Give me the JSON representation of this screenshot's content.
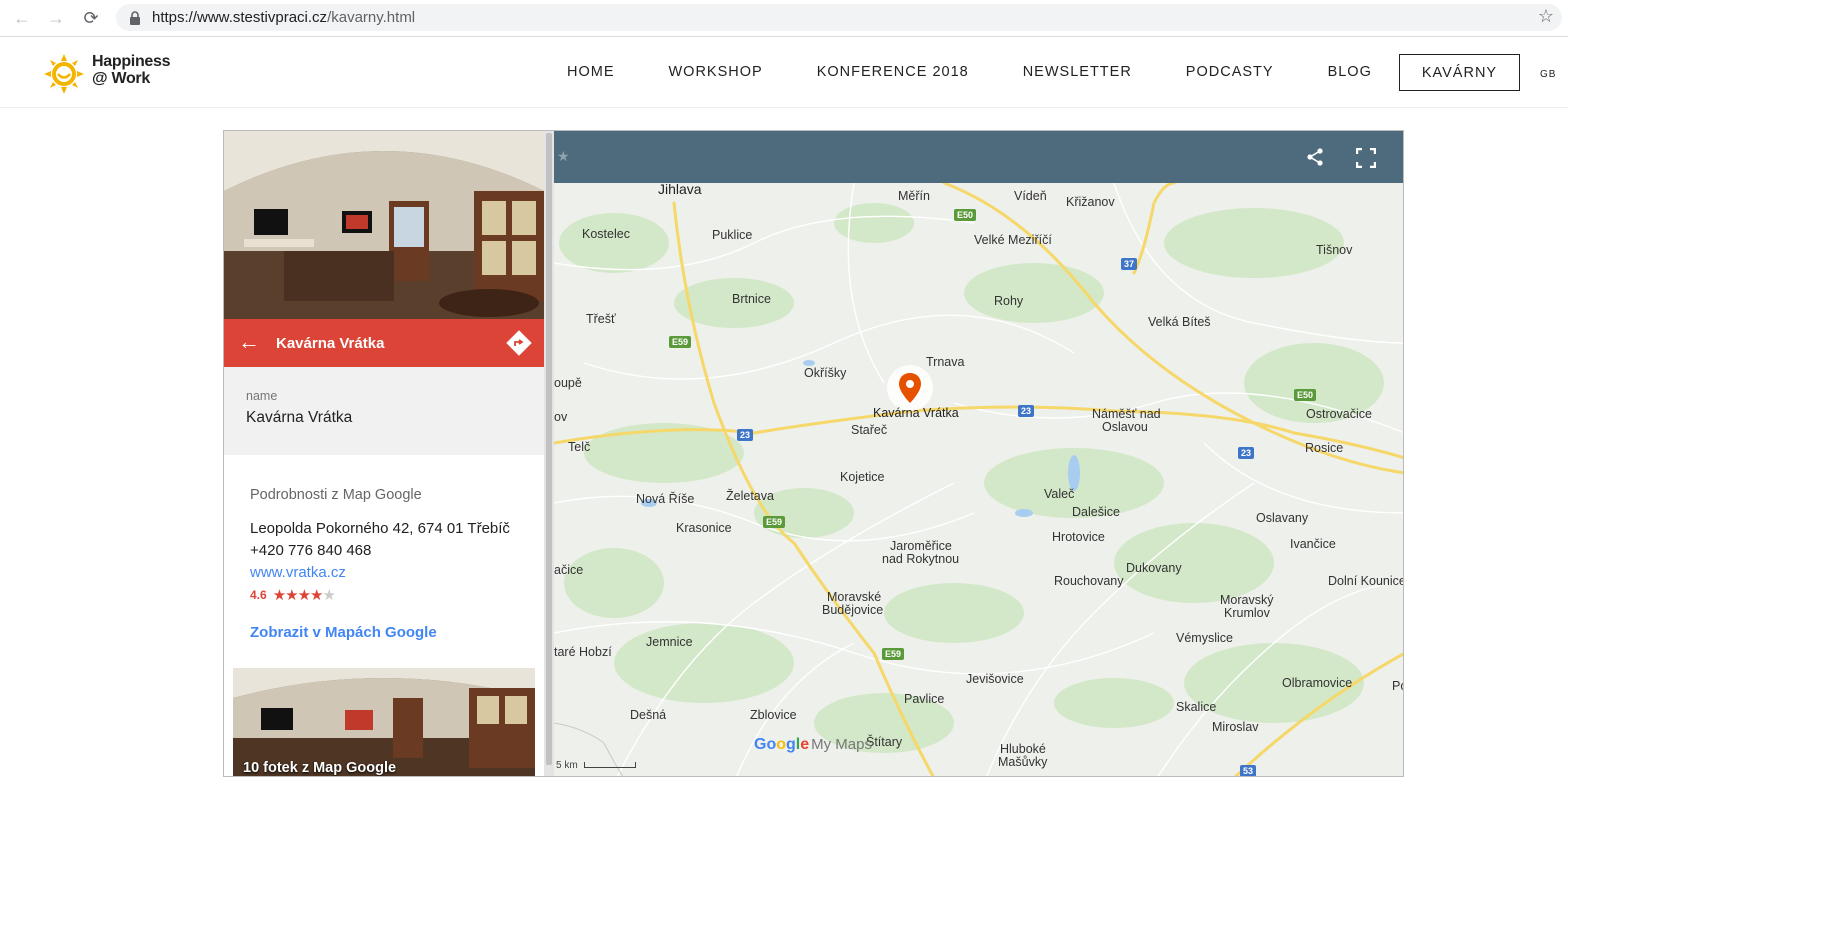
{
  "browser": {
    "url_host": "https://www.stestivpraci.cz",
    "url_path": "/kavarny.html"
  },
  "site": {
    "logo_line1": "Happiness",
    "logo_line2": "@ Work",
    "nav": [
      {
        "label": "HOME"
      },
      {
        "label": "WORKSHOP"
      },
      {
        "label": "KONFERENCE 2018"
      },
      {
        "label": "NEWSLETTER"
      },
      {
        "label": "PODCASTY"
      },
      {
        "label": "BLOG"
      },
      {
        "label": "KAVÁRNY"
      }
    ],
    "lang": "GB"
  },
  "place": {
    "title": "Kavárna Vrátka",
    "name_label": "name",
    "name_value": "Kavárna Vrátka",
    "details_heading": "Podrobnosti z Map Google",
    "address": "Leopolda Pokorného 42, 674 01 Třebíč",
    "phone": "+420 776 840 468",
    "website": "www.vratka.cz",
    "rating_text": "4.6",
    "rating": 4.6,
    "maps_link": "Zobrazit v Mapách Google",
    "photos_caption": "10 fotek z Map Google"
  },
  "map": {
    "marker_label": "Kavárna Vrátka",
    "places": [
      {
        "name": "Jihlava",
        "big": true
      },
      {
        "name": "Měřín"
      },
      {
        "name": "Vídeň"
      },
      {
        "name": "Křižanov"
      },
      {
        "name": "Kostelec"
      },
      {
        "name": "Puklice"
      },
      {
        "name": "Velké Meziříčí"
      },
      {
        "name": "Tišnov"
      },
      {
        "name": "Brtnice"
      },
      {
        "name": "Rohy"
      },
      {
        "name": "Třešť"
      },
      {
        "name": "Velká Bíteš"
      },
      {
        "name": "Trnava"
      },
      {
        "name": "Okříšky"
      },
      {
        "name": "oupě"
      },
      {
        "name": "Stařeč"
      },
      {
        "name": "Náměšť nad"
      },
      {
        "name": "Oslavou"
      },
      {
        "name": "Ostrovačice"
      },
      {
        "name": "ov"
      },
      {
        "name": "Telč"
      },
      {
        "name": "Rosice"
      },
      {
        "name": "Kojetice"
      },
      {
        "name": "Nová Říše"
      },
      {
        "name": "Želetava"
      },
      {
        "name": "Valeč"
      },
      {
        "name": "Dalešice"
      },
      {
        "name": "Oslavany"
      },
      {
        "name": "Krasonice"
      },
      {
        "name": "Hrotovice"
      },
      {
        "name": "Ivančice"
      },
      {
        "name": "Jaroměřice"
      },
      {
        "name": "nad Rokytnou"
      },
      {
        "name": "ačice"
      },
      {
        "name": "Dukovany"
      },
      {
        "name": "Rouchovany"
      },
      {
        "name": "Dolní Kounice"
      },
      {
        "name": "Moravské"
      },
      {
        "name": "Budějovice"
      },
      {
        "name": "Moravský"
      },
      {
        "name": "Krumlov"
      },
      {
        "name": "Vémyslice"
      },
      {
        "name": "Jemnice"
      },
      {
        "name": "taré Hobzí"
      },
      {
        "name": "Jevišovice"
      },
      {
        "name": "Olbramovice"
      },
      {
        "name": "Pol"
      },
      {
        "name": "Pavlice"
      },
      {
        "name": "Skalice"
      },
      {
        "name": "Dešná"
      },
      {
        "name": "Zblovice"
      },
      {
        "name": "Štítary"
      },
      {
        "name": "Miroslav"
      },
      {
        "name": "Hluboké"
      },
      {
        "name": "Mašůvky"
      }
    ],
    "road_shields": [
      {
        "label": "E50",
        "color": "green"
      },
      {
        "label": "37",
        "color": "blue"
      },
      {
        "label": "E59",
        "color": "green"
      },
      {
        "label": "E50",
        "color": "green"
      },
      {
        "label": "23",
        "color": "blue"
      },
      {
        "label": "23",
        "color": "blue"
      },
      {
        "label": "23",
        "color": "blue"
      },
      {
        "label": "E59",
        "color": "green"
      },
      {
        "label": "E59",
        "color": "green"
      },
      {
        "label": "53",
        "color": "blue"
      }
    ],
    "scale_label": "5 km",
    "logo_part1": "Go",
    "logo_part2": "o",
    "logo_part3": "g",
    "logo_part4": "l",
    "logo_part5": "e",
    "logo_suffix": "My Maps"
  },
  "colors": {
    "accent_red": "#db4437",
    "map_header": "#4d6b7c",
    "link_blue": "#4285f4"
  }
}
